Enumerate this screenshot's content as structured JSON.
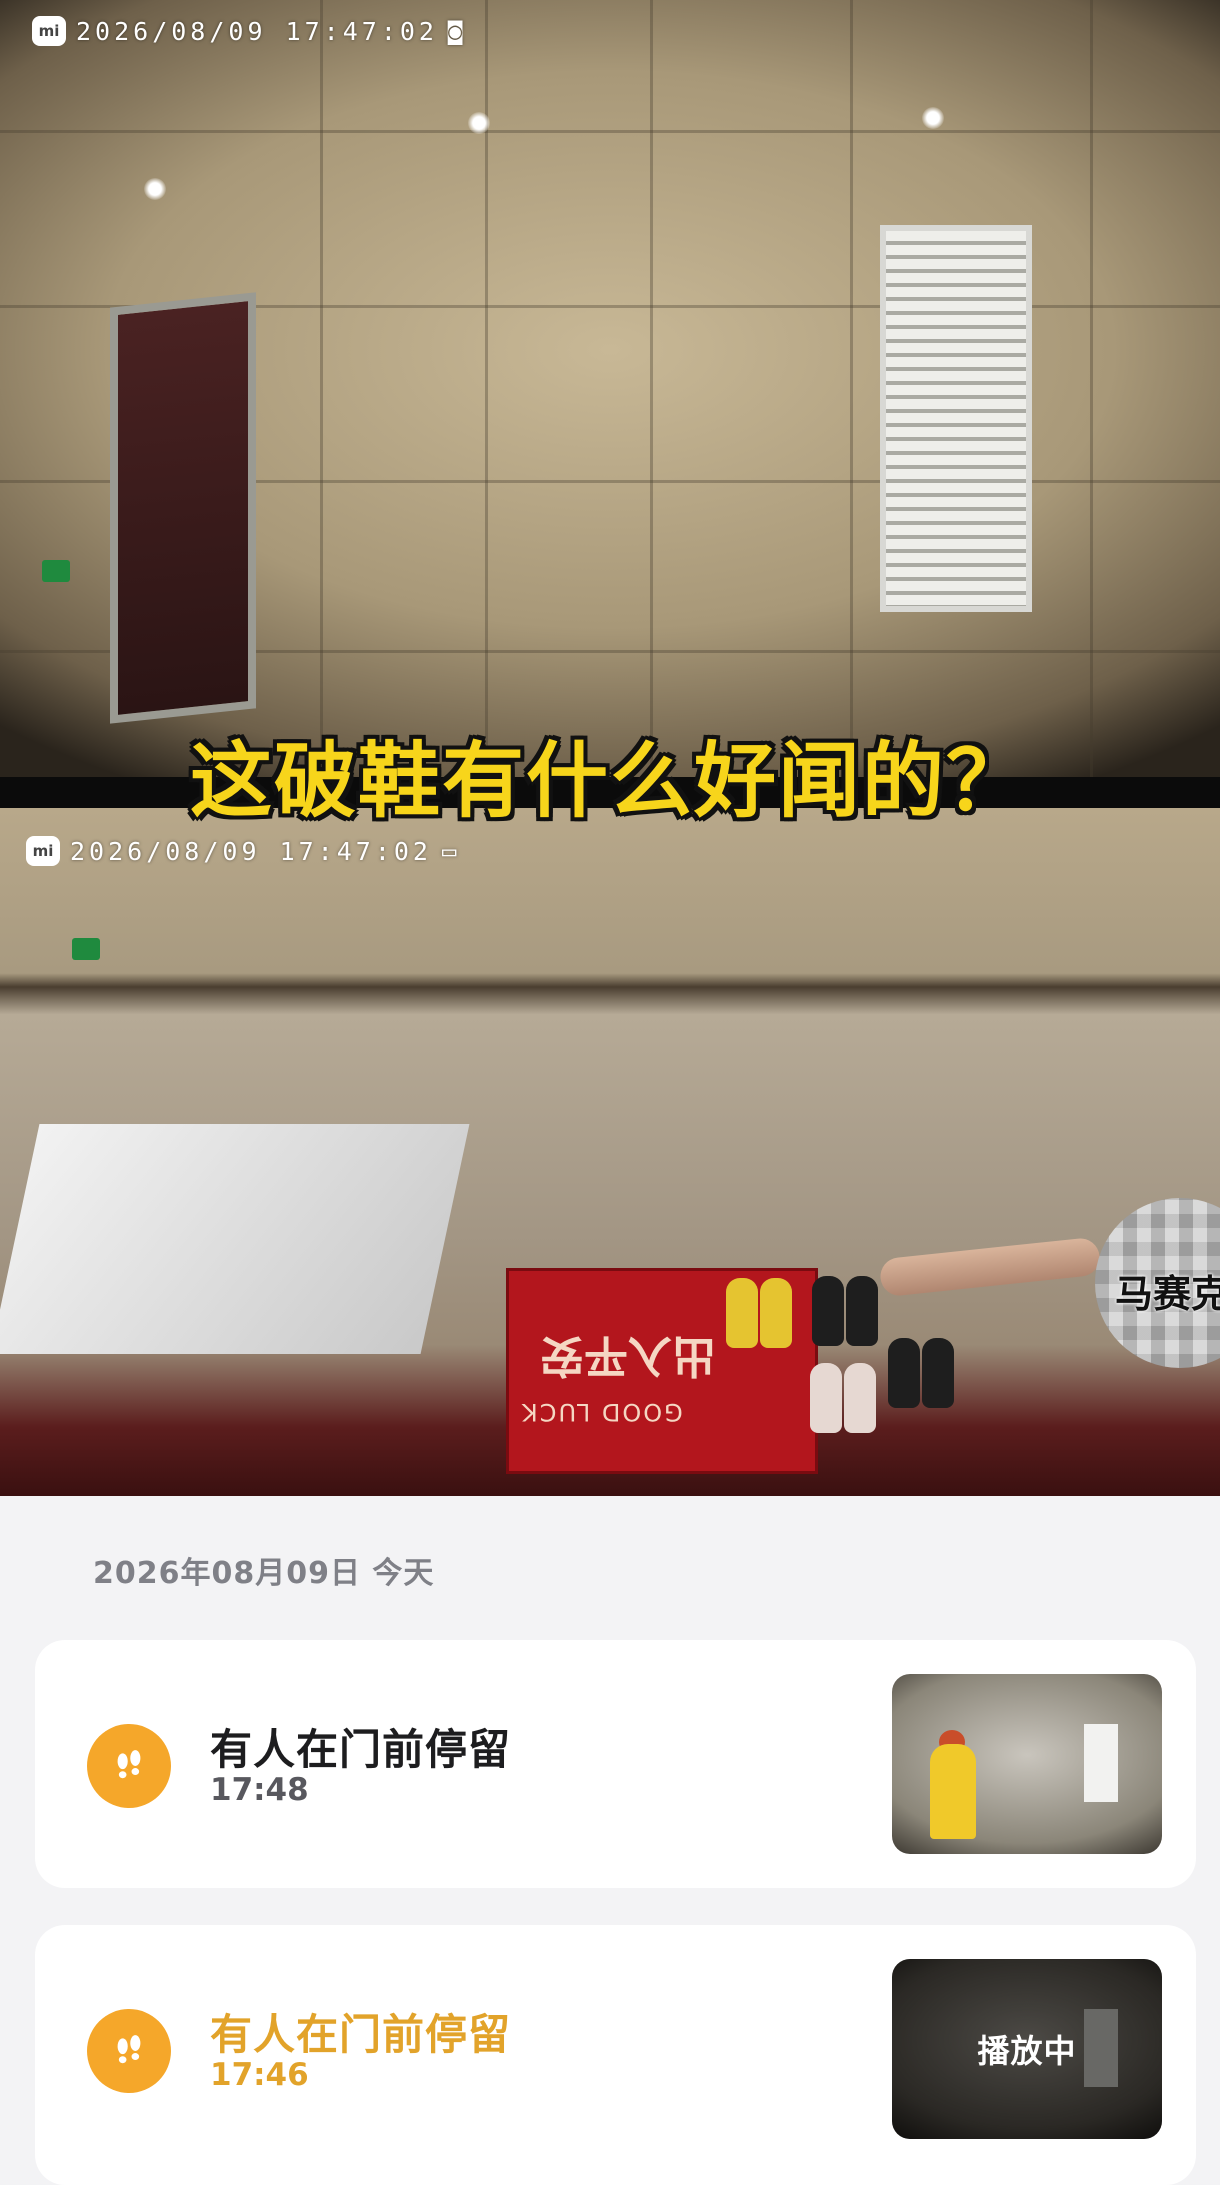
{
  "video": {
    "top_timestamp": "2026/08/09  17:47:02",
    "bottom_timestamp": "2026/08/09  17:47:02",
    "mi_logo": "mi",
    "caption": "这破鞋有什么好闻的？",
    "mosaic_label": "马赛克",
    "doormat_text_1": "出入平安",
    "doormat_text_2": "GOOD LUCK"
  },
  "date_header": "2026年08月09日  今天",
  "events": [
    {
      "title": "有人在门前停留",
      "time": "17:48",
      "active": false
    },
    {
      "title": "有人在门前停留",
      "time": "17:46",
      "active": true,
      "overlay": "播放中"
    }
  ],
  "colors": {
    "accent": "#f5a72a",
    "active_text": "#e2a32a",
    "caption": "#f7d51b"
  }
}
